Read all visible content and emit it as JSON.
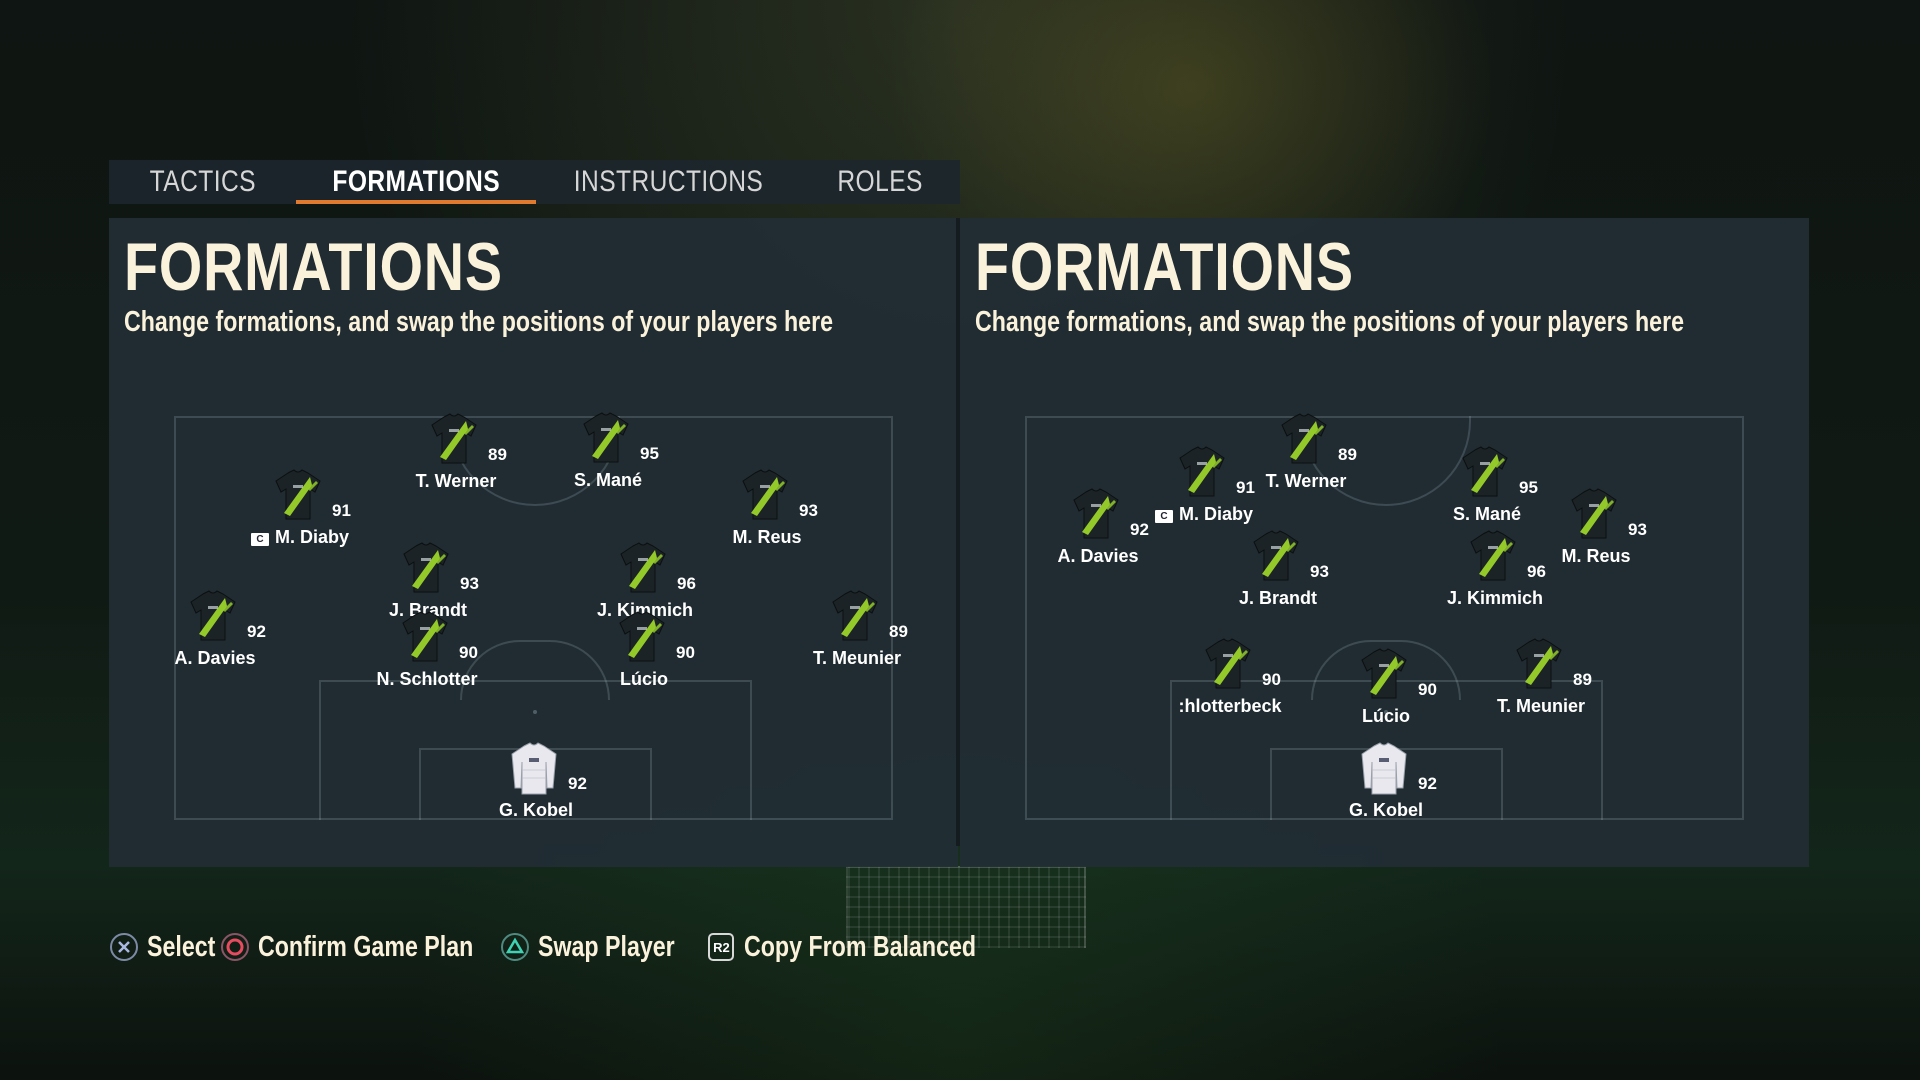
{
  "tabs": [
    {
      "label": "TACTICS",
      "active": false
    },
    {
      "label": "FORMATIONS",
      "active": true
    },
    {
      "label": "INSTRUCTIONS",
      "active": false
    },
    {
      "label": "ROLES",
      "active": false
    }
  ],
  "colors": {
    "accent": "#e07a2e",
    "panel": "#212d35",
    "title": "#fbf2dc",
    "kit": "#1c2326",
    "kit_stripe": "#9bd32a",
    "gk_kit": "#e8e8ee"
  },
  "left_panel": {
    "title": "FORMATIONS",
    "subtitle": "Change formations, and swap the positions of your players here",
    "players": [
      {
        "name": "T. Werner",
        "rating": "89",
        "kit": "outfield"
      },
      {
        "name": "S. Mané",
        "rating": "95",
        "kit": "outfield"
      },
      {
        "name": "M. Diaby",
        "rating": "91",
        "kit": "outfield",
        "captain": true
      },
      {
        "name": "M. Reus",
        "rating": "93",
        "kit": "outfield"
      },
      {
        "name": "J. Brandt",
        "rating": "93",
        "kit": "outfield"
      },
      {
        "name": "J. Kimmich",
        "rating": "96",
        "kit": "outfield"
      },
      {
        "name": "A. Davies",
        "rating": "92",
        "kit": "outfield"
      },
      {
        "name": "N. Schlotter",
        "rating": "90",
        "kit": "outfield"
      },
      {
        "name": "Lúcio",
        "rating": "90",
        "kit": "outfield"
      },
      {
        "name": "T. Meunier",
        "rating": "89",
        "kit": "outfield"
      },
      {
        "name": "G. Kobel",
        "rating": "92",
        "kit": "goalkeeper"
      }
    ]
  },
  "right_panel": {
    "title": "FORMATIONS",
    "subtitle": "Change formations, and swap the positions of your players here",
    "players": [
      {
        "name": "M. Diaby",
        "rating": "91",
        "kit": "outfield",
        "captain": true
      },
      {
        "name": "T. Werner",
        "rating": "89",
        "kit": "outfield"
      },
      {
        "name": "S. Mané",
        "rating": "95",
        "kit": "outfield"
      },
      {
        "name": "A. Davies",
        "rating": "92",
        "kit": "outfield"
      },
      {
        "name": "M. Reus",
        "rating": "93",
        "kit": "outfield"
      },
      {
        "name": "J. Brandt",
        "rating": "93",
        "kit": "outfield"
      },
      {
        "name": "J. Kimmich",
        "rating": "96",
        "kit": "outfield"
      },
      {
        "name": ":hlotterbeck",
        "rating": "90",
        "kit": "outfield"
      },
      {
        "name": "Lúcio",
        "rating": "90",
        "kit": "outfield"
      },
      {
        "name": "T. Meunier",
        "rating": "89",
        "kit": "outfield"
      },
      {
        "name": "G. Kobel",
        "rating": "92",
        "kit": "goalkeeper"
      }
    ]
  },
  "footer": {
    "select": {
      "label": "Select",
      "icon": "cross-button-icon"
    },
    "confirm": {
      "label": "Confirm Game Plan",
      "icon": "circle-button-icon"
    },
    "swap": {
      "label": "Swap Player",
      "icon": "triangle-button-icon"
    },
    "copy": {
      "label": "Copy From Balanced",
      "icon": "r2-button-icon",
      "key": "R2"
    }
  }
}
